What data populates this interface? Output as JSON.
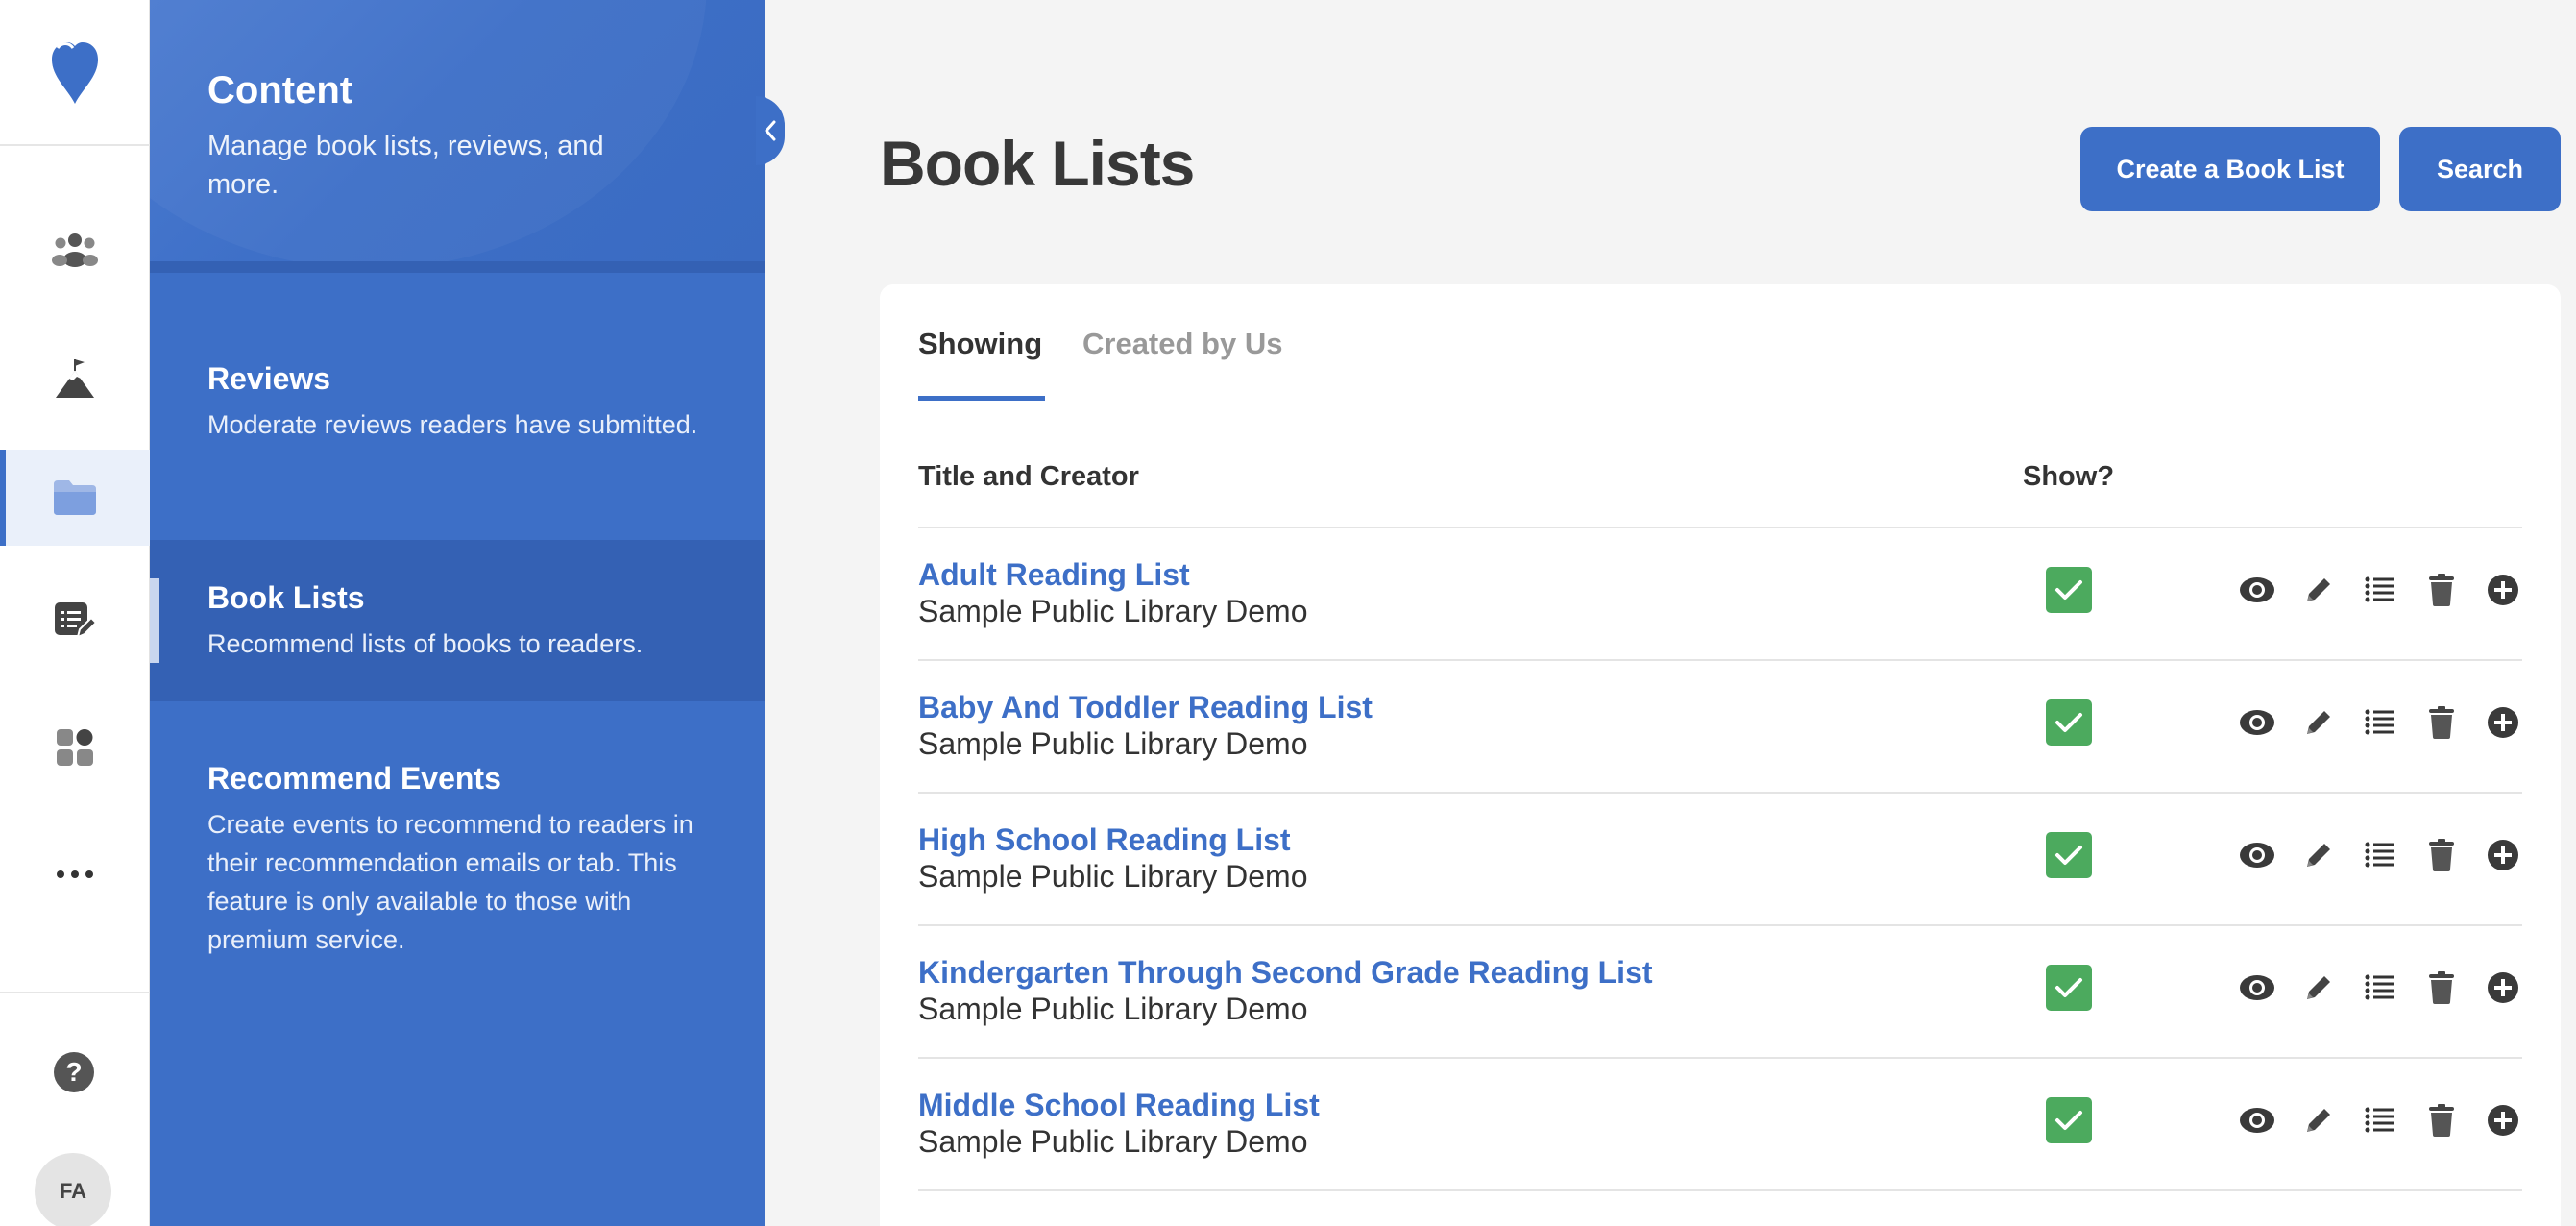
{
  "rail": {
    "logo": "heart-logo",
    "items": [
      {
        "icon": "people-icon"
      },
      {
        "icon": "mountain-flag-icon"
      },
      {
        "icon": "folder-icon",
        "active": true
      },
      {
        "icon": "edit-list-icon"
      },
      {
        "icon": "apps-grid-icon"
      },
      {
        "icon": "more-icon"
      }
    ],
    "help_label": "?",
    "avatar_initials": "FA"
  },
  "panel": {
    "title": "Content",
    "subtitle": "Manage book lists, reviews, and more.",
    "items": [
      {
        "title": "Reviews",
        "description": "Moderate reviews readers have submitted."
      },
      {
        "title": "Book Lists",
        "description": "Recommend lists of books to readers."
      },
      {
        "title": "Recommend Events",
        "description": "Create events to recommend to readers in their recommendation emails or tab. This feature is only available to those with premium service."
      }
    ]
  },
  "main": {
    "title": "Book Lists",
    "buttons": {
      "create": "Create a Book List",
      "search": "Search"
    },
    "tabs": [
      {
        "label": "Showing",
        "active": true
      },
      {
        "label": "Created by Us",
        "active": false
      }
    ],
    "columns": {
      "title_creator": "Title and Creator",
      "show": "Show?"
    },
    "rows": [
      {
        "title": "Adult Reading List",
        "creator": "Sample Public Library Demo",
        "show": true
      },
      {
        "title": "Baby And Toddler Reading List",
        "creator": "Sample Public Library Demo",
        "show": true
      },
      {
        "title": "High School Reading List",
        "creator": "Sample Public Library Demo",
        "show": true
      },
      {
        "title": "Kindergarten Through Second Grade Reading List",
        "creator": "Sample Public Library Demo",
        "show": true
      },
      {
        "title": "Middle School Reading List",
        "creator": "Sample Public Library Demo",
        "show": true
      }
    ],
    "row_actions": [
      "view-icon",
      "edit-icon",
      "list-icon",
      "delete-icon",
      "add-icon"
    ]
  },
  "colors": {
    "accent": "#3d6fc7",
    "panel_active": "#3461b4",
    "check_green": "#4caa5e",
    "title_text": "#383838"
  }
}
